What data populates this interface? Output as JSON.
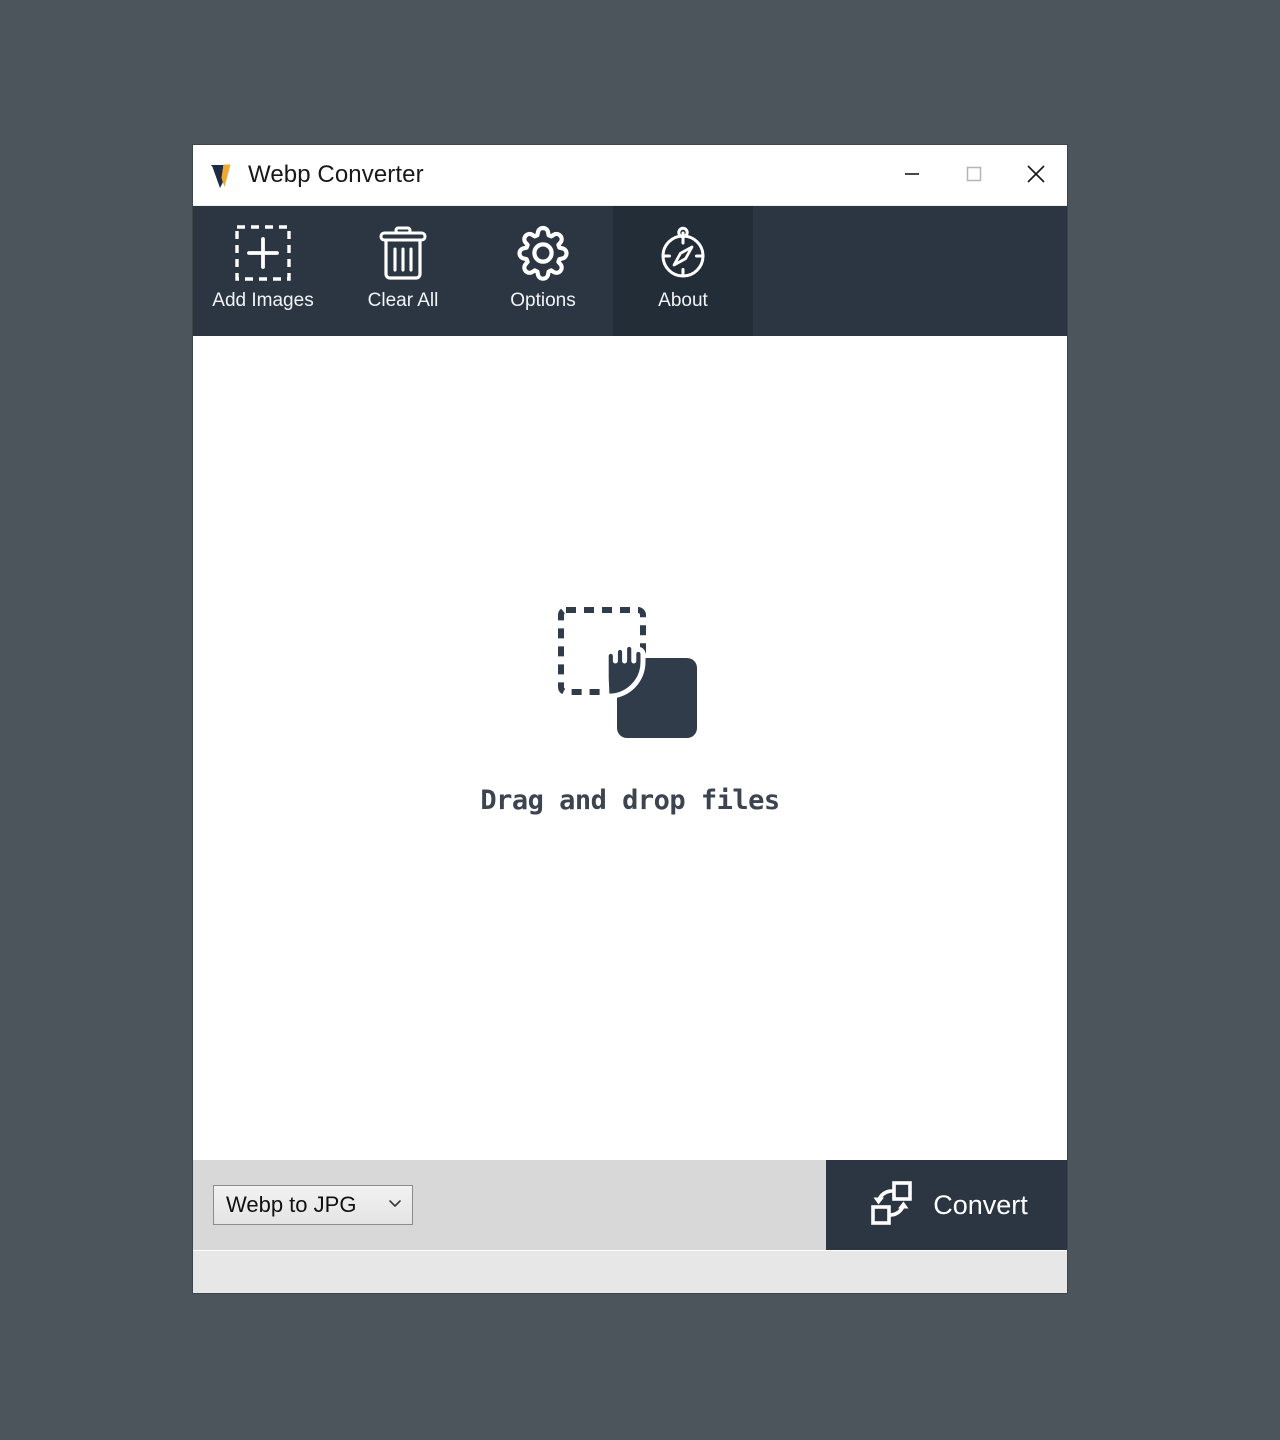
{
  "window": {
    "title": "Webp Converter",
    "logo_icon": "webp-w-logo",
    "logo_colors": {
      "dark": "#1f2a44",
      "accent": "#f0a830"
    },
    "controls": [
      {
        "name": "minimize",
        "icon": "minimize-icon",
        "glyph": "—"
      },
      {
        "name": "maximize",
        "icon": "maximize-icon",
        "glyph": "□"
      },
      {
        "name": "close",
        "icon": "close-icon",
        "glyph": "✕"
      }
    ]
  },
  "toolbar": {
    "background": "#2b3642",
    "active_background": "#222d38",
    "items": [
      {
        "label": "Add Images",
        "icon": "add-images-icon",
        "active": false
      },
      {
        "label": "Clear All",
        "icon": "trash-icon",
        "active": false
      },
      {
        "label": "Options",
        "icon": "gear-icon",
        "active": false
      },
      {
        "label": "About",
        "icon": "compass-icon",
        "active": true
      }
    ]
  },
  "drop_area": {
    "icon": "drag-and-drop-icon",
    "message": "Drag and drop files",
    "background": "#ffffff"
  },
  "action_bar": {
    "background": "#d8d8d8",
    "format_select": {
      "value": "Webp to JPG",
      "chevron_icon": "chevron-down-icon"
    },
    "convert_button": {
      "label": "Convert",
      "icon": "convert-icon",
      "background": "#2b3642"
    }
  },
  "status_bar": {
    "text": "",
    "background": "#e7e7e7"
  },
  "desktop": {
    "background": "#4c545c"
  }
}
